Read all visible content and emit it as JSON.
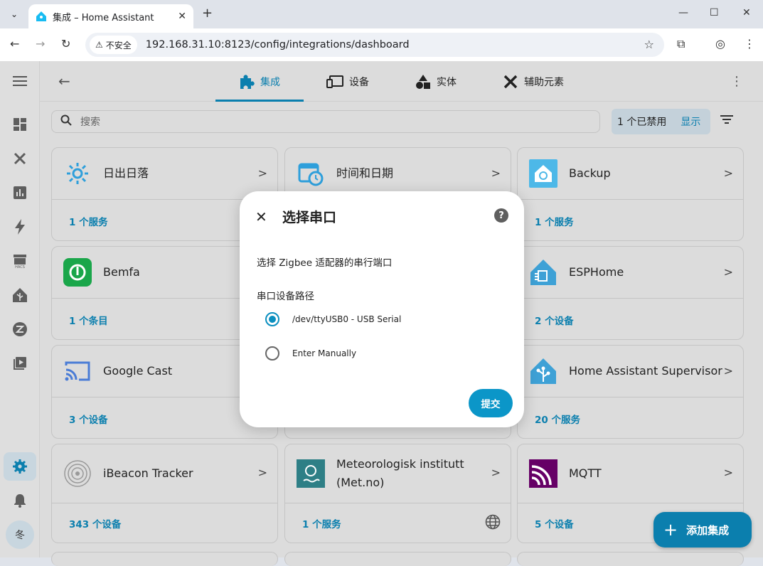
{
  "browser": {
    "tab_title": "集成 – Home Assistant",
    "security_label": "不安全",
    "url": "192.168.31.10:8123/config/integrations/dashboard"
  },
  "ha": {
    "tabs": [
      {
        "label": "集成",
        "icon": "puzzle-icon",
        "active": true
      },
      {
        "label": "设备",
        "icon": "devices-icon",
        "active": false
      },
      {
        "label": "实体",
        "icon": "shapes-icon",
        "active": false
      },
      {
        "label": "辅助元素",
        "icon": "tools-icon",
        "active": false
      }
    ],
    "search_placeholder": "搜索",
    "disabled_text": "1 个已禁用",
    "show_label": "显示",
    "fab_label": "添加集成",
    "avatar_text": "冬",
    "accent_color": "#0b7fae"
  },
  "cards": [
    {
      "name": "日出日落",
      "footer": "1 个服务",
      "icon": "sun-icon"
    },
    {
      "name": "时间和日期",
      "footer": "",
      "icon": "calendar-clock-icon"
    },
    {
      "name": "Backup",
      "footer": "1 个服务",
      "icon": "backup-icon"
    },
    {
      "name": "Bemfa",
      "footer": "1 个条目",
      "icon": "bemfa-icon",
      "badge": "package-icon"
    },
    {
      "name": "",
      "footer": "",
      "icon": ""
    },
    {
      "name": "ESPHome",
      "footer": "2 个设备",
      "icon": "esphome-icon"
    },
    {
      "name": "Google Cast",
      "footer": "3 个设备",
      "icon": "cast-icon"
    },
    {
      "name": "",
      "footer": "",
      "icon": ""
    },
    {
      "name": "Home Assistant Supervisor",
      "footer": "20 个服务",
      "icon": "ha-supervisor-icon"
    },
    {
      "name": "iBeacon Tracker",
      "footer": "343 个设备",
      "icon": "ibeacon-icon"
    },
    {
      "name": "Meteorologisk institutt (Met.no)",
      "footer": "1 个服务",
      "icon": "met-icon",
      "badge": "globe-icon"
    },
    {
      "name": "MQTT",
      "footer": "5 个设备",
      "icon": "mqtt-icon"
    }
  ],
  "dialog": {
    "title": "选择串口",
    "description": "选择 Zigbee 适配器的串行端口",
    "field_label": "串口设备路径",
    "options": [
      {
        "label": "/dev/ttyUSB0 - USB Serial",
        "selected": true
      },
      {
        "label": "Enter Manually",
        "selected": false
      }
    ],
    "submit_label": "提交"
  }
}
